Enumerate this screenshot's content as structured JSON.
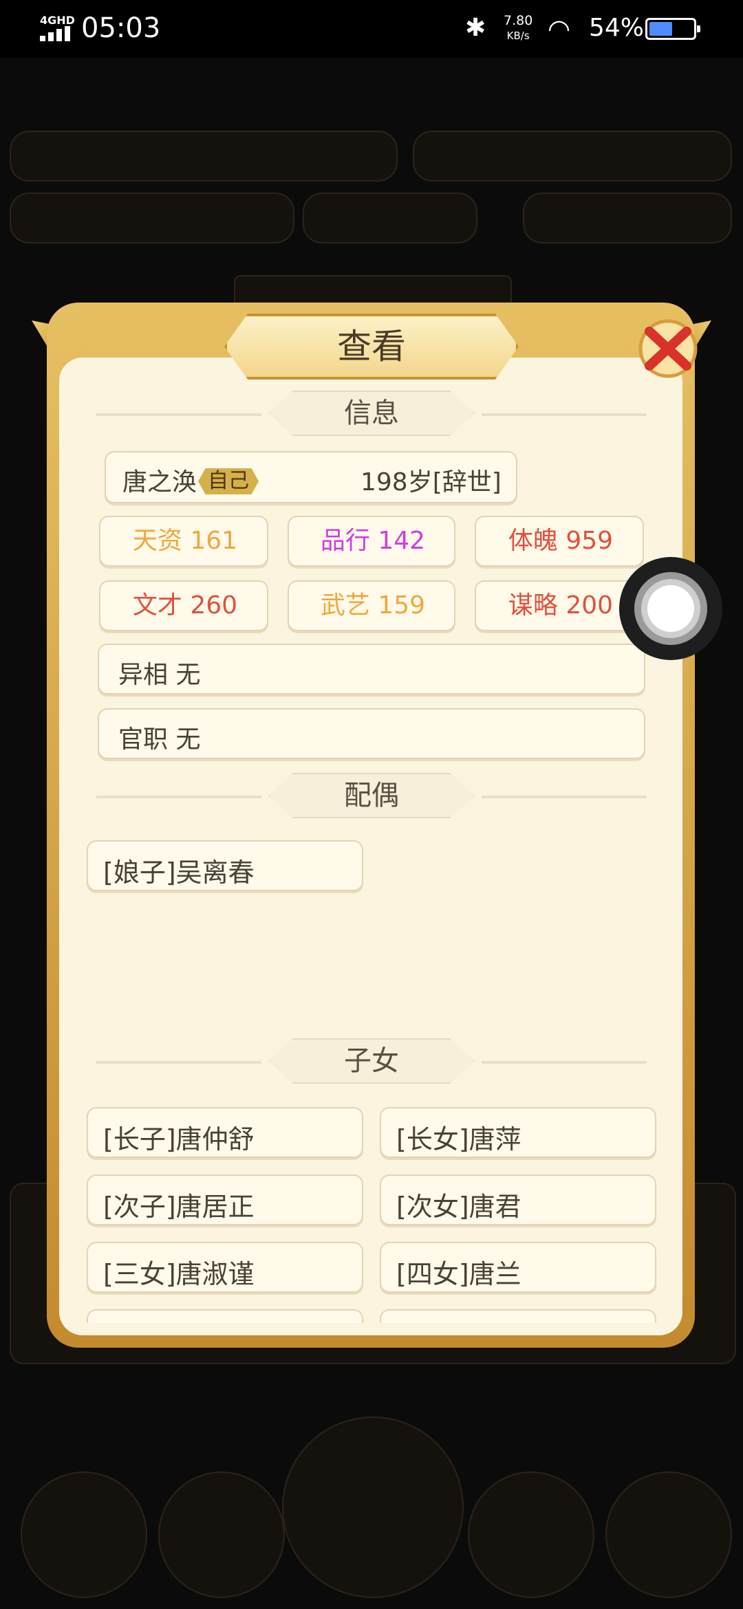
{
  "status_bar": {
    "network": "4GHD",
    "time": "05:03",
    "speed_value": "7.80",
    "speed_unit": "KB/s",
    "battery_pct": "54%",
    "battery_level": 0.54
  },
  "dialog": {
    "title": "查看",
    "info_header": "信息",
    "spouse_header": "配偶",
    "children_header": "子女",
    "name": "唐之涣",
    "self_badge": "自己",
    "age_status": "198岁[辞世]",
    "stats": [
      {
        "label": "天资",
        "value": "161",
        "color": "#f0a73a"
      },
      {
        "label": "品行",
        "value": "142",
        "color": "#d23be0"
      },
      {
        "label": "体魄",
        "value": "959",
        "color": "#e0503e"
      },
      {
        "label": "文才",
        "value": "260",
        "color": "#e0503e"
      },
      {
        "label": "武艺",
        "value": "159",
        "color": "#f0a73a"
      },
      {
        "label": "谋略",
        "value": "200",
        "color": "#e0503e"
      }
    ],
    "trait_label": "异相",
    "trait_value": "无",
    "office_label": "官职",
    "office_value": "无",
    "spouses": [
      "[娘子]吴离春"
    ],
    "children": [
      "[长子]唐仲舒",
      "[长女]唐萍",
      "[次子]唐居正",
      "[次女]唐君",
      "[三女]唐淑谨",
      "[四女]唐兰"
    ]
  }
}
